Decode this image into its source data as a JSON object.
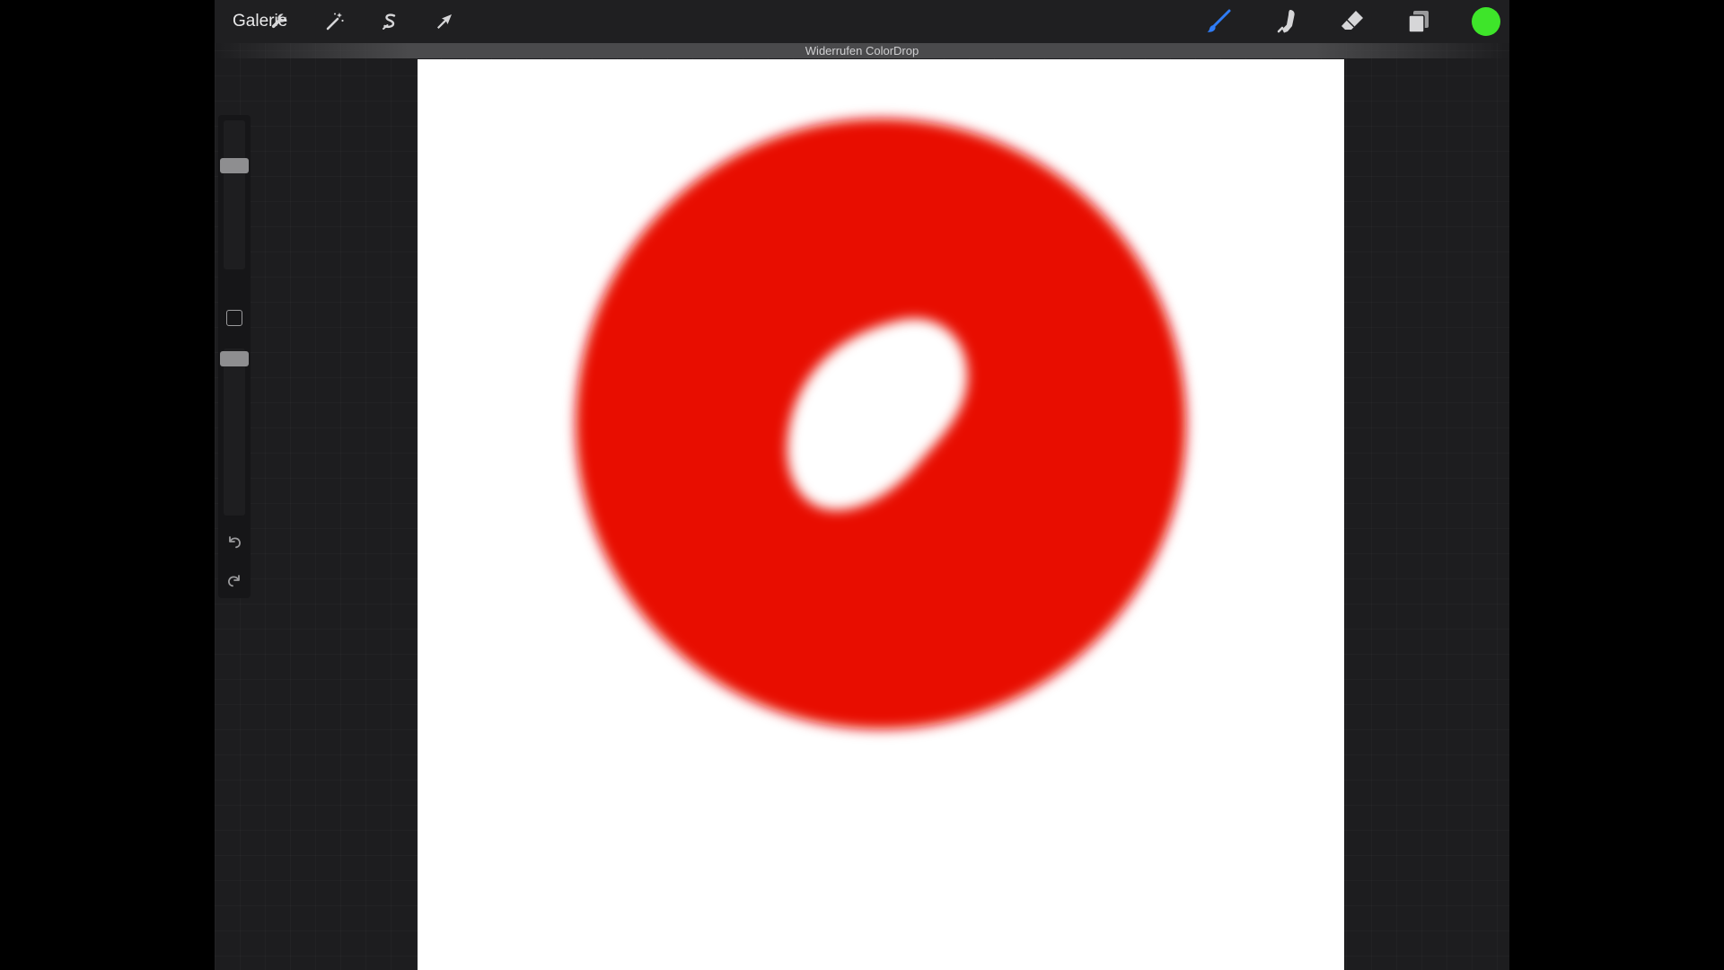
{
  "toolbar": {
    "gallery_label": "Galerie",
    "left_tools": [
      {
        "name": "actions",
        "icon": "wrench-icon"
      },
      {
        "name": "adjustments",
        "icon": "magic-wand-icon"
      },
      {
        "name": "selection",
        "icon": "selection-s-icon"
      },
      {
        "name": "transform",
        "icon": "arrow-cursor-icon"
      }
    ],
    "right_tools": [
      {
        "name": "brush",
        "icon": "paintbrush-icon",
        "active": true
      },
      {
        "name": "smudge",
        "icon": "smudge-finger-icon",
        "active": false
      },
      {
        "name": "eraser",
        "icon": "eraser-icon",
        "active": false
      },
      {
        "name": "layers",
        "icon": "layers-icon",
        "active": false
      }
    ],
    "current_color": "#3ee52a",
    "active_tool_color": "#2f7cf6"
  },
  "status": {
    "message": "Widerrufen ColorDrop"
  },
  "canvas": {
    "background": "#ffffff",
    "stroke_color": "#e80f05"
  },
  "sidebar": {
    "brush_size_level": 0.72,
    "opacity_level": 0.98,
    "icons": {
      "modify": "square-icon",
      "undo": "undo-arrow-icon",
      "redo": "redo-arrow-icon"
    }
  }
}
